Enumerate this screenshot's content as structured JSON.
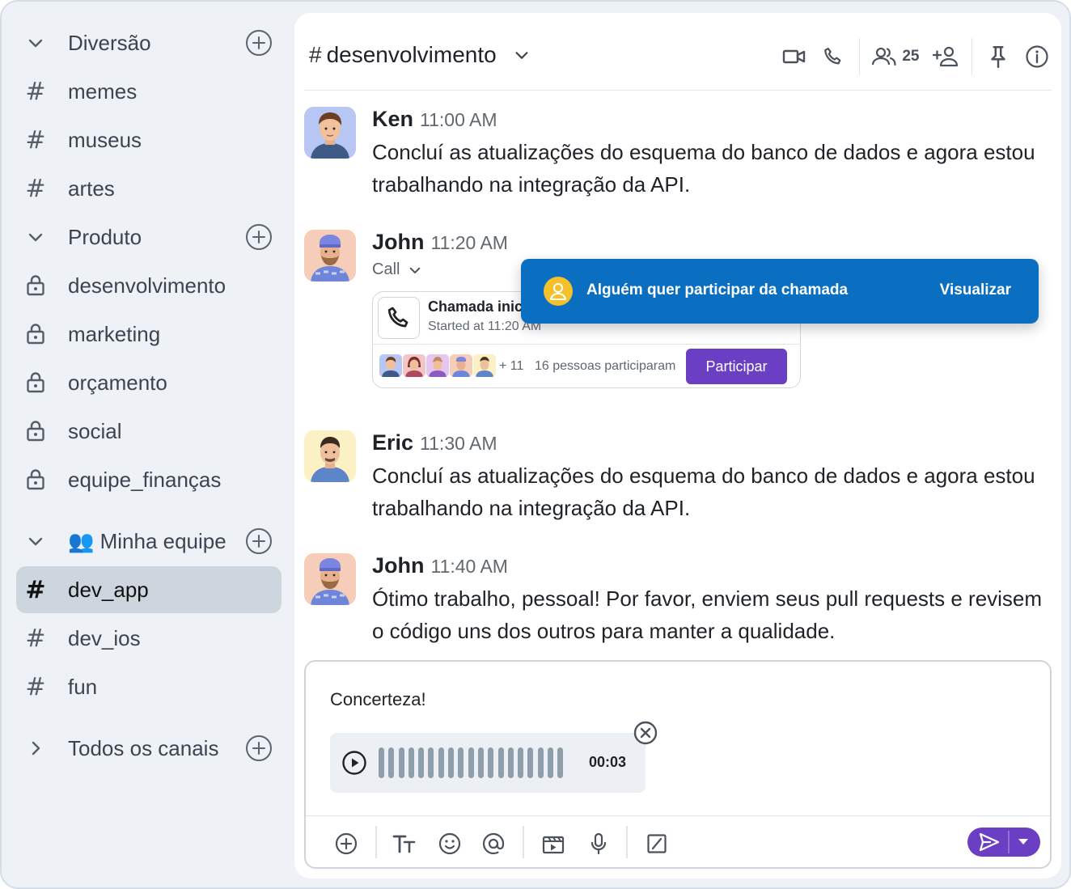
{
  "sidebar": {
    "items": [
      {
        "type": "section",
        "label": "Diversão",
        "expanded": true
      },
      {
        "type": "channel",
        "label": "memes"
      },
      {
        "type": "channel",
        "label": "museus"
      },
      {
        "type": "channel",
        "label": "artes"
      },
      {
        "type": "section",
        "label": "Produto",
        "expanded": true
      },
      {
        "type": "private",
        "label": "desenvolvimento"
      },
      {
        "type": "private",
        "label": "marketing"
      },
      {
        "type": "private",
        "label": "orçamento"
      },
      {
        "type": "private",
        "label": "social"
      },
      {
        "type": "private",
        "label": "equipe_finanças"
      },
      {
        "type": "section",
        "label": "👥 Minha equipe",
        "expanded": true
      },
      {
        "type": "channel",
        "label": "dev_app",
        "active": true
      },
      {
        "type": "channel",
        "label": "dev_ios"
      },
      {
        "type": "channel",
        "label": "fun"
      },
      {
        "type": "section",
        "label": "Todos os canais",
        "expanded": false
      }
    ]
  },
  "header": {
    "hash": "#",
    "channel": "desenvolvimento",
    "member_count": "25"
  },
  "messages": [
    {
      "author": "Ken",
      "time": "11:00 AM",
      "text": "Concluí as atualizações do esquema do banco de dados e agora estou trabalhando na integração da API."
    },
    {
      "author": "John",
      "time": "11:20 AM",
      "call_label": "Call"
    },
    {
      "author": "Eric",
      "time": "11:30 AM",
      "text": "Concluí as atualizações do esquema do banco de dados e agora estou trabalhando na integração da API."
    },
    {
      "author": "John",
      "time": "11:40 AM",
      "text": "Ótimo trabalho, pessoal! Por favor, enviem seus pull requests e revisem o código uns dos outros para manter a qualidade."
    }
  ],
  "call_card": {
    "title": "Chamada inici",
    "started": "Started at 11:20 AM",
    "more": "+ 11",
    "participants": "16 pessoas participaram",
    "join_label": "Participar"
  },
  "toast": {
    "text": "Alguém quer participar da chamada",
    "action": "Visualizar"
  },
  "composer": {
    "draft": "Concerteza!",
    "voice_duration": "00:03"
  },
  "colors": {
    "accent": "#6a3fc4",
    "toast": "#0b6fc1",
    "active_row": "#cdd6de",
    "sidebar_bg": "#eef2f7"
  }
}
